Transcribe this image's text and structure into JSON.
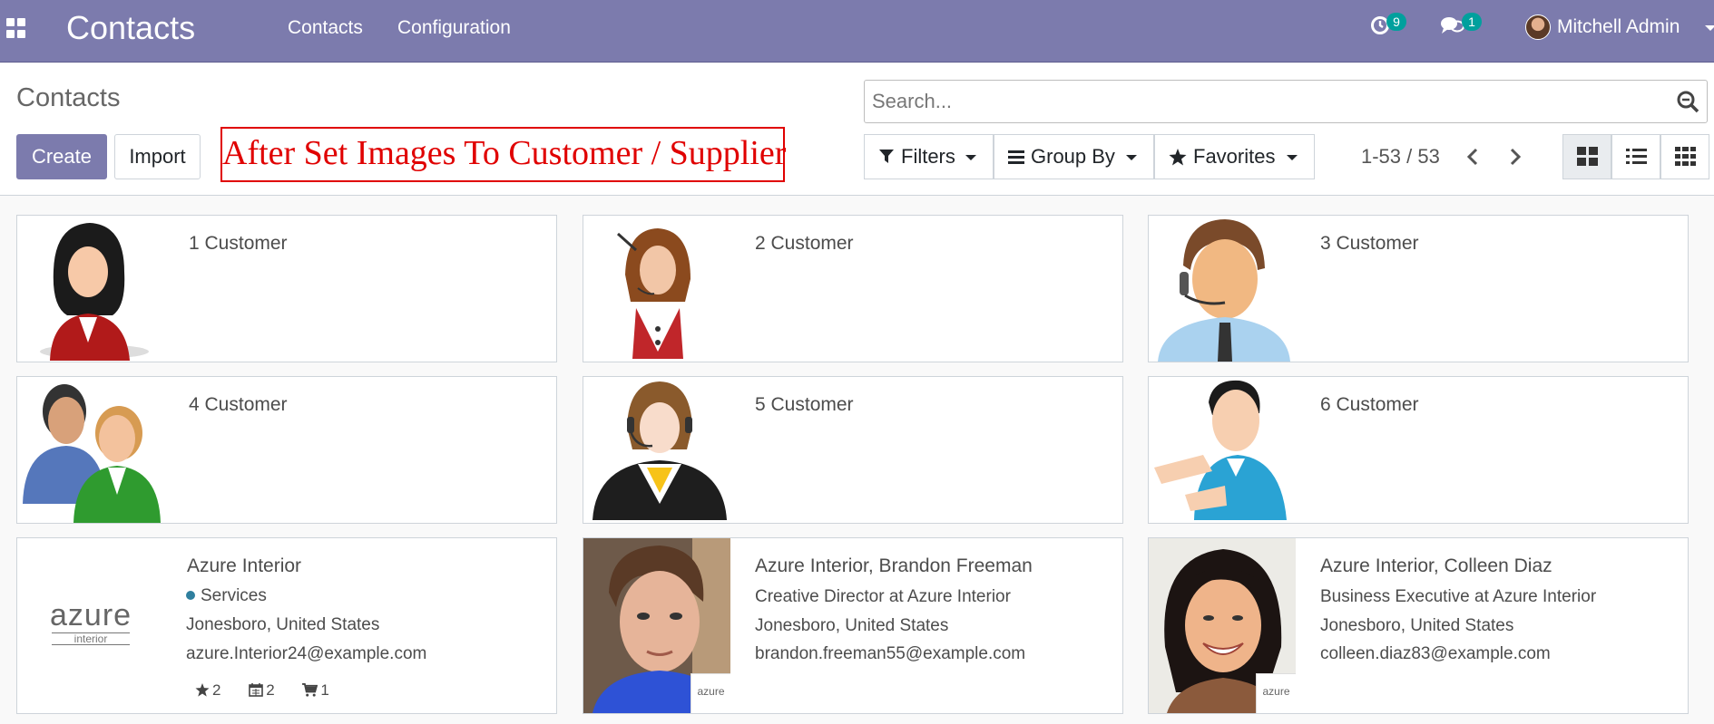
{
  "navbar": {
    "brand": "Contacts",
    "menu": [
      {
        "label": "Contacts"
      },
      {
        "label": "Configuration"
      }
    ],
    "activity_count": "9",
    "messages_count": "1",
    "user_name": "Mitchell Admin",
    "bg_color": "#7c7bad",
    "badge_color": "#00a09d"
  },
  "control": {
    "breadcrumb": "Contacts",
    "create_label": "Create",
    "import_label": "Import",
    "annotation": "After Set Images To Customer / Supplier",
    "search_placeholder": "Search...",
    "filters_label": "Filters",
    "groupby_label": "Group By",
    "favorites_label": "Favorites",
    "pager": "1-53 / 53",
    "views": [
      "kanban-view",
      "list-view",
      "grid-view"
    ],
    "active_view": "kanban-view"
  },
  "cards": [
    {
      "name": "1 Customer",
      "image": "female-customer-red-icon"
    },
    {
      "name": "2 Customer",
      "image": "female-headset-customer-icon"
    },
    {
      "name": "3 Customer",
      "image": "male-headset-agent-icon"
    },
    {
      "name": "4 Customer",
      "image": "couple-customers-icon"
    },
    {
      "name": "5 Customer",
      "image": "female-support-agent-icon"
    },
    {
      "name": "6 Customer",
      "image": "male-presenting-customer-icon"
    },
    {
      "name": "Azure Interior",
      "image": "azure-interior-logo",
      "logo_text": "azure",
      "logo_sub": "interior",
      "tag": "Services",
      "location": "Jonesboro, United States",
      "email": "azure.Interior24@example.com",
      "stats": {
        "opportunities": "2",
        "meetings": "2",
        "sales": "1"
      }
    },
    {
      "name": "Azure Interior, Brandon Freeman",
      "image": "brandon-freeman-photo",
      "function": "Creative Director at Azure Interior",
      "location": "Jonesboro, United States",
      "email": "brandon.freeman55@example.com",
      "company_logo": "azure"
    },
    {
      "name": "Azure Interior, Colleen Diaz",
      "image": "colleen-diaz-photo",
      "function": "Business Executive at Azure Interior",
      "location": "Jonesboro, United States",
      "email": "colleen.diaz83@example.com",
      "company_logo": "azure"
    }
  ]
}
